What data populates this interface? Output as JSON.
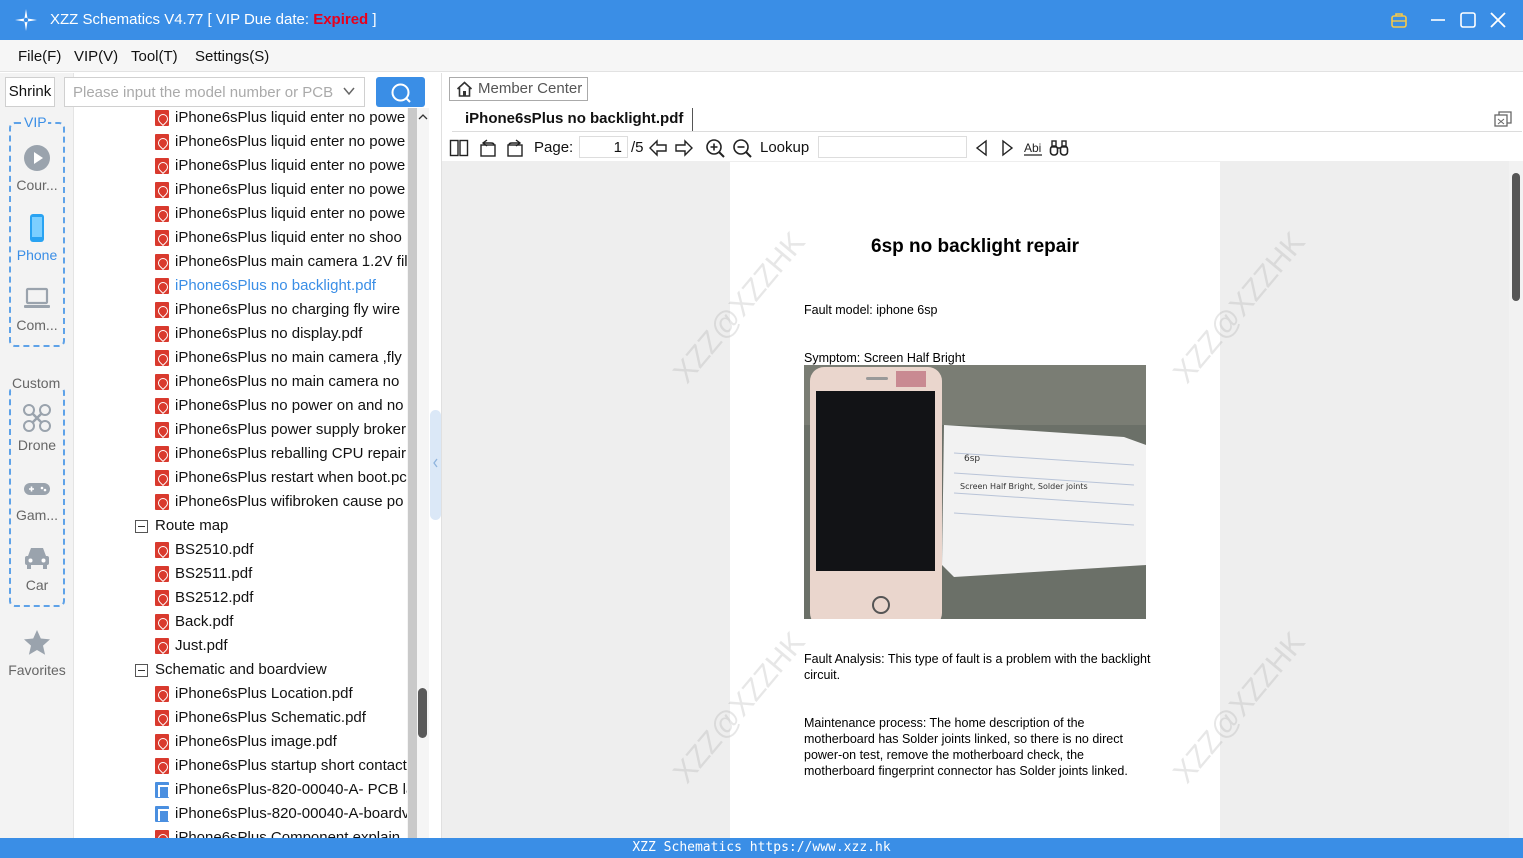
{
  "window": {
    "title_prefix": "XZZ Schematics V4.77 [ VIP Due date: ",
    "title_expired": "Expired",
    "title_suffix": " ]",
    "accent_color": "#3a8ee6",
    "expired_color": "#e8001c"
  },
  "menu": [
    "File(F)",
    "VIP(V)",
    "Tool(T)",
    "Settings(S)"
  ],
  "leftnav": {
    "shrink_label": "Shrink",
    "vip_group_label": "VIP",
    "custom_group_label": "Custom",
    "items": [
      {
        "label": "Cour...",
        "icon": "play-circle-icon"
      },
      {
        "label": "Phone",
        "icon": "phone-icon",
        "active": true
      },
      {
        "label": "Com...",
        "icon": "laptop-icon"
      },
      {
        "label": "Drone",
        "icon": "drone-icon"
      },
      {
        "label": "Gam...",
        "icon": "gamepad-icon"
      },
      {
        "label": "Car",
        "icon": "car-icon"
      },
      {
        "label": "Favorites",
        "icon": "star-icon"
      }
    ]
  },
  "search": {
    "placeholder": "Please input the model number or PCB",
    "button_icon": "search-icon"
  },
  "tree": {
    "files_a": [
      "iPhone6sPlus liquid enter no powe",
      "iPhone6sPlus liquid enter no powe",
      "iPhone6sPlus liquid enter no powe",
      "iPhone6sPlus liquid enter no powe",
      "iPhone6sPlus liquid enter no powe",
      "iPhone6sPlus liquid enter no shoo",
      "iPhone6sPlus main camera 1.2V fil",
      "iPhone6sPlus no backlight.pdf",
      "iPhone6sPlus no charging fly wire",
      "iPhone6sPlus no display.pdf",
      "iPhone6sPlus no main camera ,fly",
      "iPhone6sPlus no main camera no",
      "iPhone6sPlus no power on and no",
      "iPhone6sPlus power supply broker",
      "iPhone6sPlus reballing CPU repair",
      "iPhone6sPlus restart when boot.pc",
      "iPhone6sPlus wifibroken cause po"
    ],
    "selected_index": 7,
    "group_route": "Route map",
    "files_route": [
      "BS2510.pdf",
      "BS2511.pdf",
      "BS2512.pdf",
      "Back.pdf",
      "Just.pdf"
    ],
    "group_schematic": "Schematic and boardview",
    "files_schematic": [
      {
        "name": "iPhone6sPlus Location.pdf",
        "type": "pdf"
      },
      {
        "name": "iPhone6sPlus Schematic.pdf",
        "type": "pdf"
      },
      {
        "name": "iPhone6sPlus image.pdf",
        "type": "pdf"
      },
      {
        "name": "iPhone6sPlus startup short contact",
        "type": "pdf"
      },
      {
        "name": "iPhone6sPlus-820-00040-A- PCB la",
        "type": "boardview"
      },
      {
        "name": "iPhone6sPlus-820-00040-A-boardv",
        "type": "boardview"
      },
      {
        "name": "iPhone6sPlus Component explain",
        "type": "pdf"
      }
    ]
  },
  "viewer": {
    "member_center": "Member Center",
    "tab_title": "iPhone6sPlus no backlight.pdf",
    "page_label": "Page:",
    "page_current": "1",
    "page_total": "/5",
    "lookup_label": "Lookup",
    "toolbar_icons": [
      "two-page-icon",
      "rotate-left-icon",
      "rotate-right-icon",
      "prev-page-icon",
      "next-page-icon",
      "zoom-in-icon",
      "zoom-out-icon",
      "find-prev-icon",
      "find-next-icon",
      "match-case-icon",
      "binoculars-icon"
    ]
  },
  "document": {
    "title": "6sp no backlight repair",
    "fault_model": "Fault model: iphone 6sp",
    "symptom": "Symptom: Screen Half Bright",
    "analysis": "Fault Analysis: This type of fault is a problem with the backlight circuit.",
    "process": "Maintenance process: The home description of the motherboard has Solder joints linked, so there is no direct power-on test, remove the motherboard check, the motherboard fingerprint connector has Solder joints linked.",
    "watermark": "XZZ@XZZHK",
    "photo_note_line1": "6sp",
    "photo_note_line2": "Screen Half Bright, Solder joints"
  },
  "statusbar": "XZZ Schematics https://www.xzz.hk"
}
